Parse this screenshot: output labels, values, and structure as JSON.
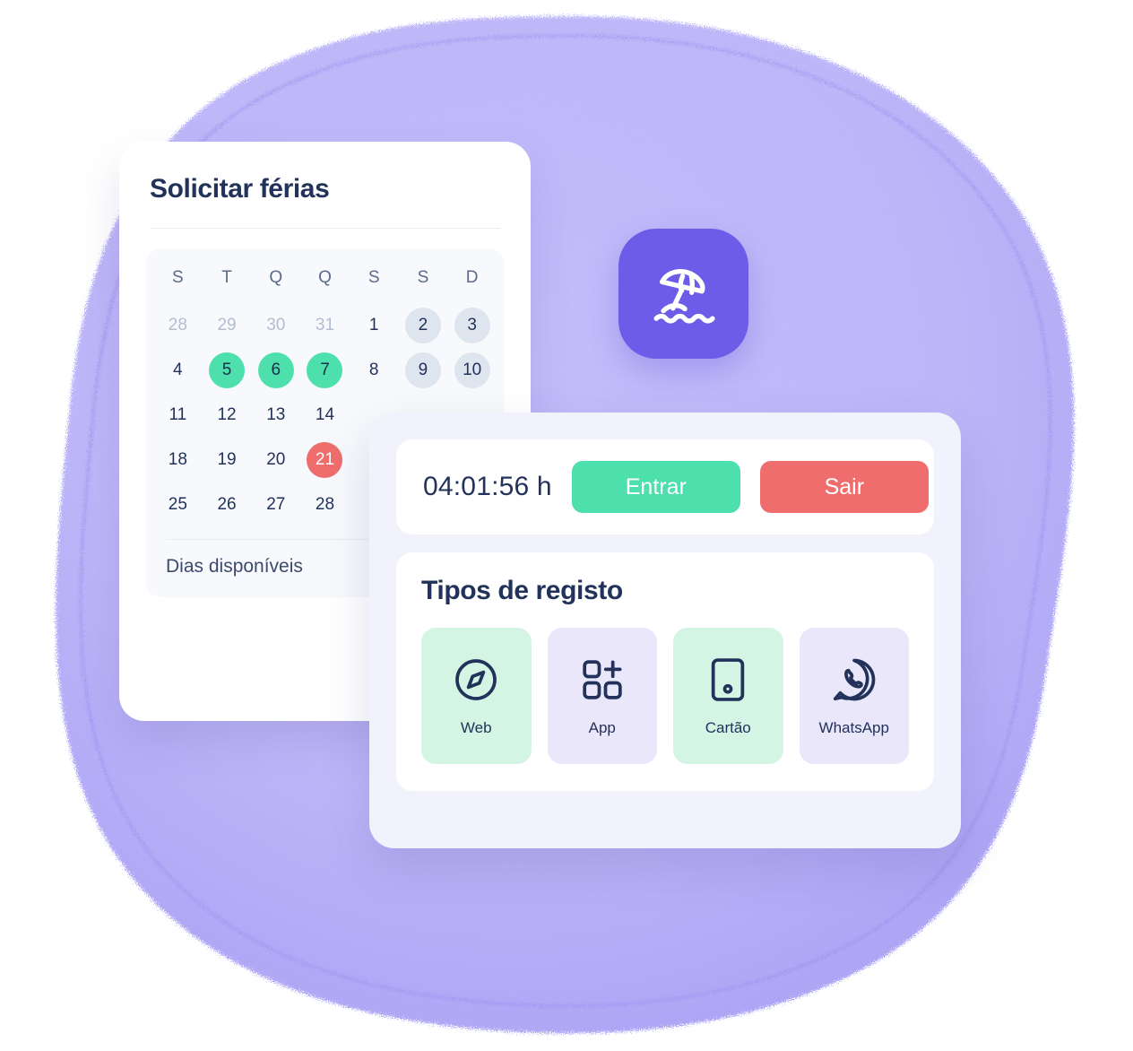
{
  "colors": {
    "blob_purple": "#b9b3f7",
    "accent_purple": "#6c5ce7",
    "green": "#4ee0ac",
    "red": "#ef6d6d",
    "weekend_gray": "#dfe5ee",
    "navy_text": "#22325a",
    "mint_tile": "#d4f5e4",
    "lavender_tile": "#eae7fb"
  },
  "beach_icon": {
    "name": "beach-umbrella-icon"
  },
  "vacation_card": {
    "title": "Solicitar férias",
    "weekday_headers": [
      "S",
      "T",
      "Q",
      "Q",
      "S",
      "S",
      "D"
    ],
    "weeks": [
      [
        {
          "label": "28",
          "state": "muted"
        },
        {
          "label": "29",
          "state": "muted"
        },
        {
          "label": "30",
          "state": "muted"
        },
        {
          "label": "31",
          "state": "muted"
        },
        {
          "label": "1",
          "state": "normal"
        },
        {
          "label": "2",
          "state": "weekend"
        },
        {
          "label": "3",
          "state": "weekend"
        }
      ],
      [
        {
          "label": "4",
          "state": "normal"
        },
        {
          "label": "5",
          "state": "selected"
        },
        {
          "label": "6",
          "state": "selected"
        },
        {
          "label": "7",
          "state": "selected"
        },
        {
          "label": "8",
          "state": "normal"
        },
        {
          "label": "9",
          "state": "weekend"
        },
        {
          "label": "10",
          "state": "weekend"
        }
      ],
      [
        {
          "label": "11",
          "state": "normal"
        },
        {
          "label": "12",
          "state": "normal"
        },
        {
          "label": "13",
          "state": "normal"
        },
        {
          "label": "14",
          "state": "normal"
        },
        {
          "label": "",
          "state": "blank"
        },
        {
          "label": "",
          "state": "blank"
        },
        {
          "label": "",
          "state": "blank"
        }
      ],
      [
        {
          "label": "18",
          "state": "normal"
        },
        {
          "label": "19",
          "state": "normal"
        },
        {
          "label": "20",
          "state": "normal"
        },
        {
          "label": "21",
          "state": "today"
        },
        {
          "label": "",
          "state": "blank"
        },
        {
          "label": "",
          "state": "blank"
        },
        {
          "label": "",
          "state": "blank"
        }
      ],
      [
        {
          "label": "25",
          "state": "normal"
        },
        {
          "label": "26",
          "state": "normal"
        },
        {
          "label": "27",
          "state": "normal"
        },
        {
          "label": "28",
          "state": "normal"
        },
        {
          "label": "",
          "state": "blank"
        },
        {
          "label": "",
          "state": "blank"
        },
        {
          "label": "",
          "state": "blank"
        }
      ]
    ],
    "footer_label": "Dias disponíveis"
  },
  "registo_panel": {
    "clock": {
      "elapsed": "04:01:56 h",
      "clock_in_label": "Entrar",
      "clock_out_label": "Sair"
    },
    "types": {
      "title": "Tipos de registo",
      "items": [
        {
          "label": "Web",
          "icon": "compass-icon",
          "tone": "mint"
        },
        {
          "label": "App",
          "icon": "app-grid-icon",
          "tone": "lav"
        },
        {
          "label": "Cartão",
          "icon": "card-badge-icon",
          "tone": "mint"
        },
        {
          "label": "WhatsApp",
          "icon": "whatsapp-icon",
          "tone": "lav"
        }
      ]
    }
  }
}
